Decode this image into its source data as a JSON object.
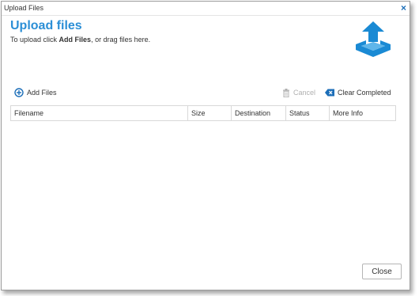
{
  "window": {
    "title": "Upload Files",
    "close_glyph": "×"
  },
  "header": {
    "title": "Upload files",
    "instructions_prefix": "To upload click ",
    "instructions_bold": "Add Files",
    "instructions_suffix": ", or drag files here.",
    "graphic_icon": "upload-tray-icon"
  },
  "toolbar": {
    "add_files_label": "Add Files",
    "add_files_icon": "plus-circle-icon",
    "cancel_label": "Cancel",
    "cancel_icon": "trash-icon",
    "cancel_enabled": false,
    "clear_completed_label": "Clear Completed",
    "clear_completed_icon": "backspace-x-icon"
  },
  "table": {
    "columns": [
      "Filename",
      "Size",
      "Destination",
      "Status",
      "More Info"
    ],
    "rows": []
  },
  "footer": {
    "close_label": "Close"
  },
  "colors": {
    "accent": "#2c8fd6",
    "title_x": "#1c6eb8",
    "disabled": "#b0b0b0"
  }
}
